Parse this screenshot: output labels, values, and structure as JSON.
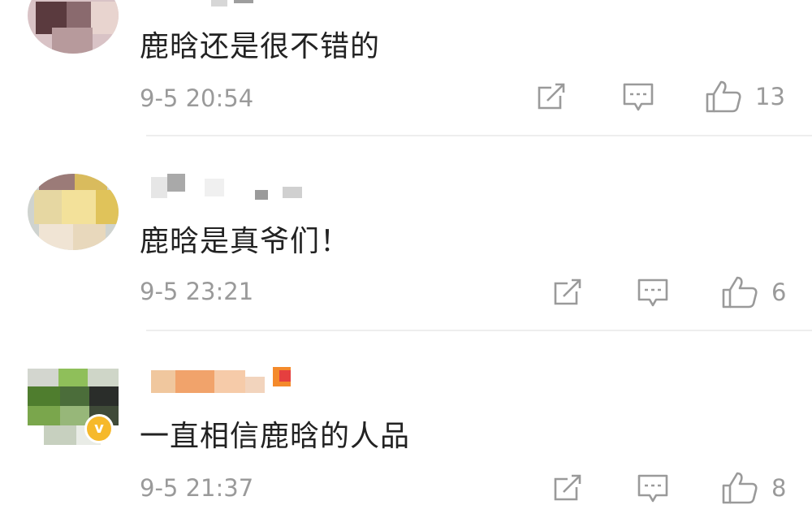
{
  "comments": [
    {
      "text": "鹿晗还是很不错的",
      "time": "9-5 20:54",
      "likes": "13"
    },
    {
      "text": "鹿晗是真爷们！",
      "time": "9-5 23:21",
      "likes": "6"
    },
    {
      "text": "一直相信鹿晗的人品",
      "time": "9-5 21:37",
      "likes": "8"
    }
  ],
  "icons": {
    "share": "share-icon",
    "comment": "comment-icon",
    "like": "thumbs-up-icon",
    "verified": "verified-badge-icon"
  },
  "colors": {
    "text": "#222222",
    "meta": "#9a9a9a",
    "divider": "#eeeeee",
    "badge": "#f6b92b"
  }
}
